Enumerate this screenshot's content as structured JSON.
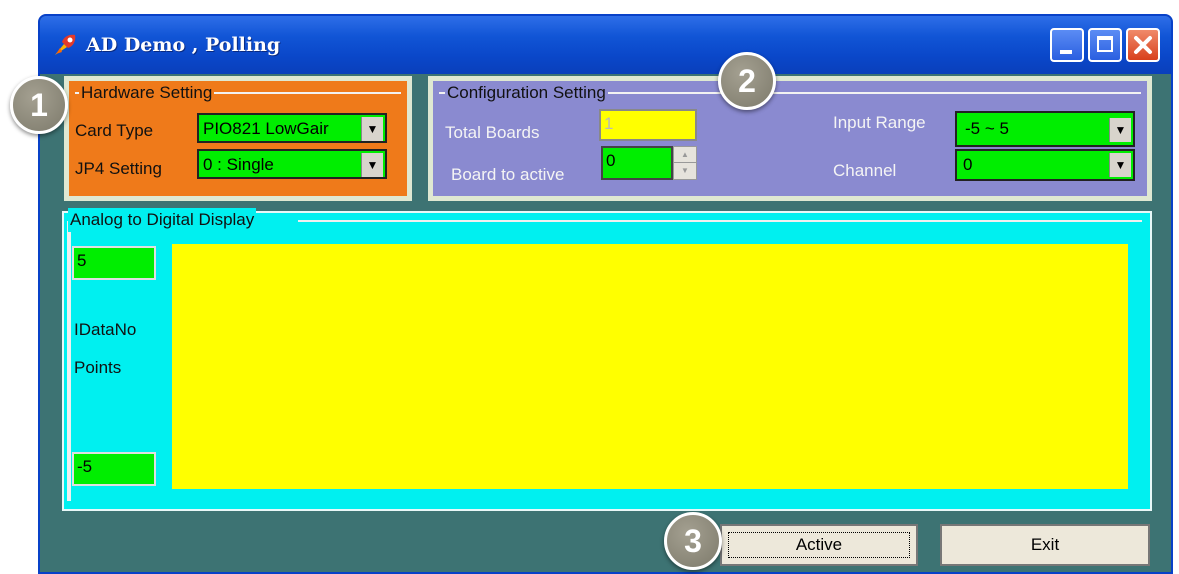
{
  "window": {
    "title": "AD Demo , Polling",
    "icon": "app-icon"
  },
  "hardware": {
    "group_label": "Hardware Setting",
    "card_type_label": "Card Type",
    "card_type_value": "PIO821 LowGair",
    "jp4_label": "JP4 Setting",
    "jp4_value": "0 : Single"
  },
  "config": {
    "group_label": "Configuration Setting",
    "total_boards_label": "Total Boards",
    "total_boards_value": "1",
    "board_active_label": "Board to active",
    "board_active_value": "0",
    "input_range_label": "Input Range",
    "input_range_value": "-5 ~ 5",
    "channel_label": "Channel",
    "channel_value": "0"
  },
  "ad_display": {
    "group_label": "Analog to Digital Display",
    "max_value": "5",
    "min_value": "-5",
    "data_no_label": "IDataNo",
    "points_label": "Points"
  },
  "buttons": {
    "active": "Active",
    "exit": "Exit"
  },
  "callouts": [
    "1",
    "2",
    "3"
  ],
  "colors": {
    "hardware_panel": "#ef7a1a",
    "config_panel": "#8a8ad0",
    "ad_panel": "#00f0f0",
    "plot_area": "#ffff00",
    "combo_bg": "#00ee00",
    "window_bg": "#3d7373"
  }
}
